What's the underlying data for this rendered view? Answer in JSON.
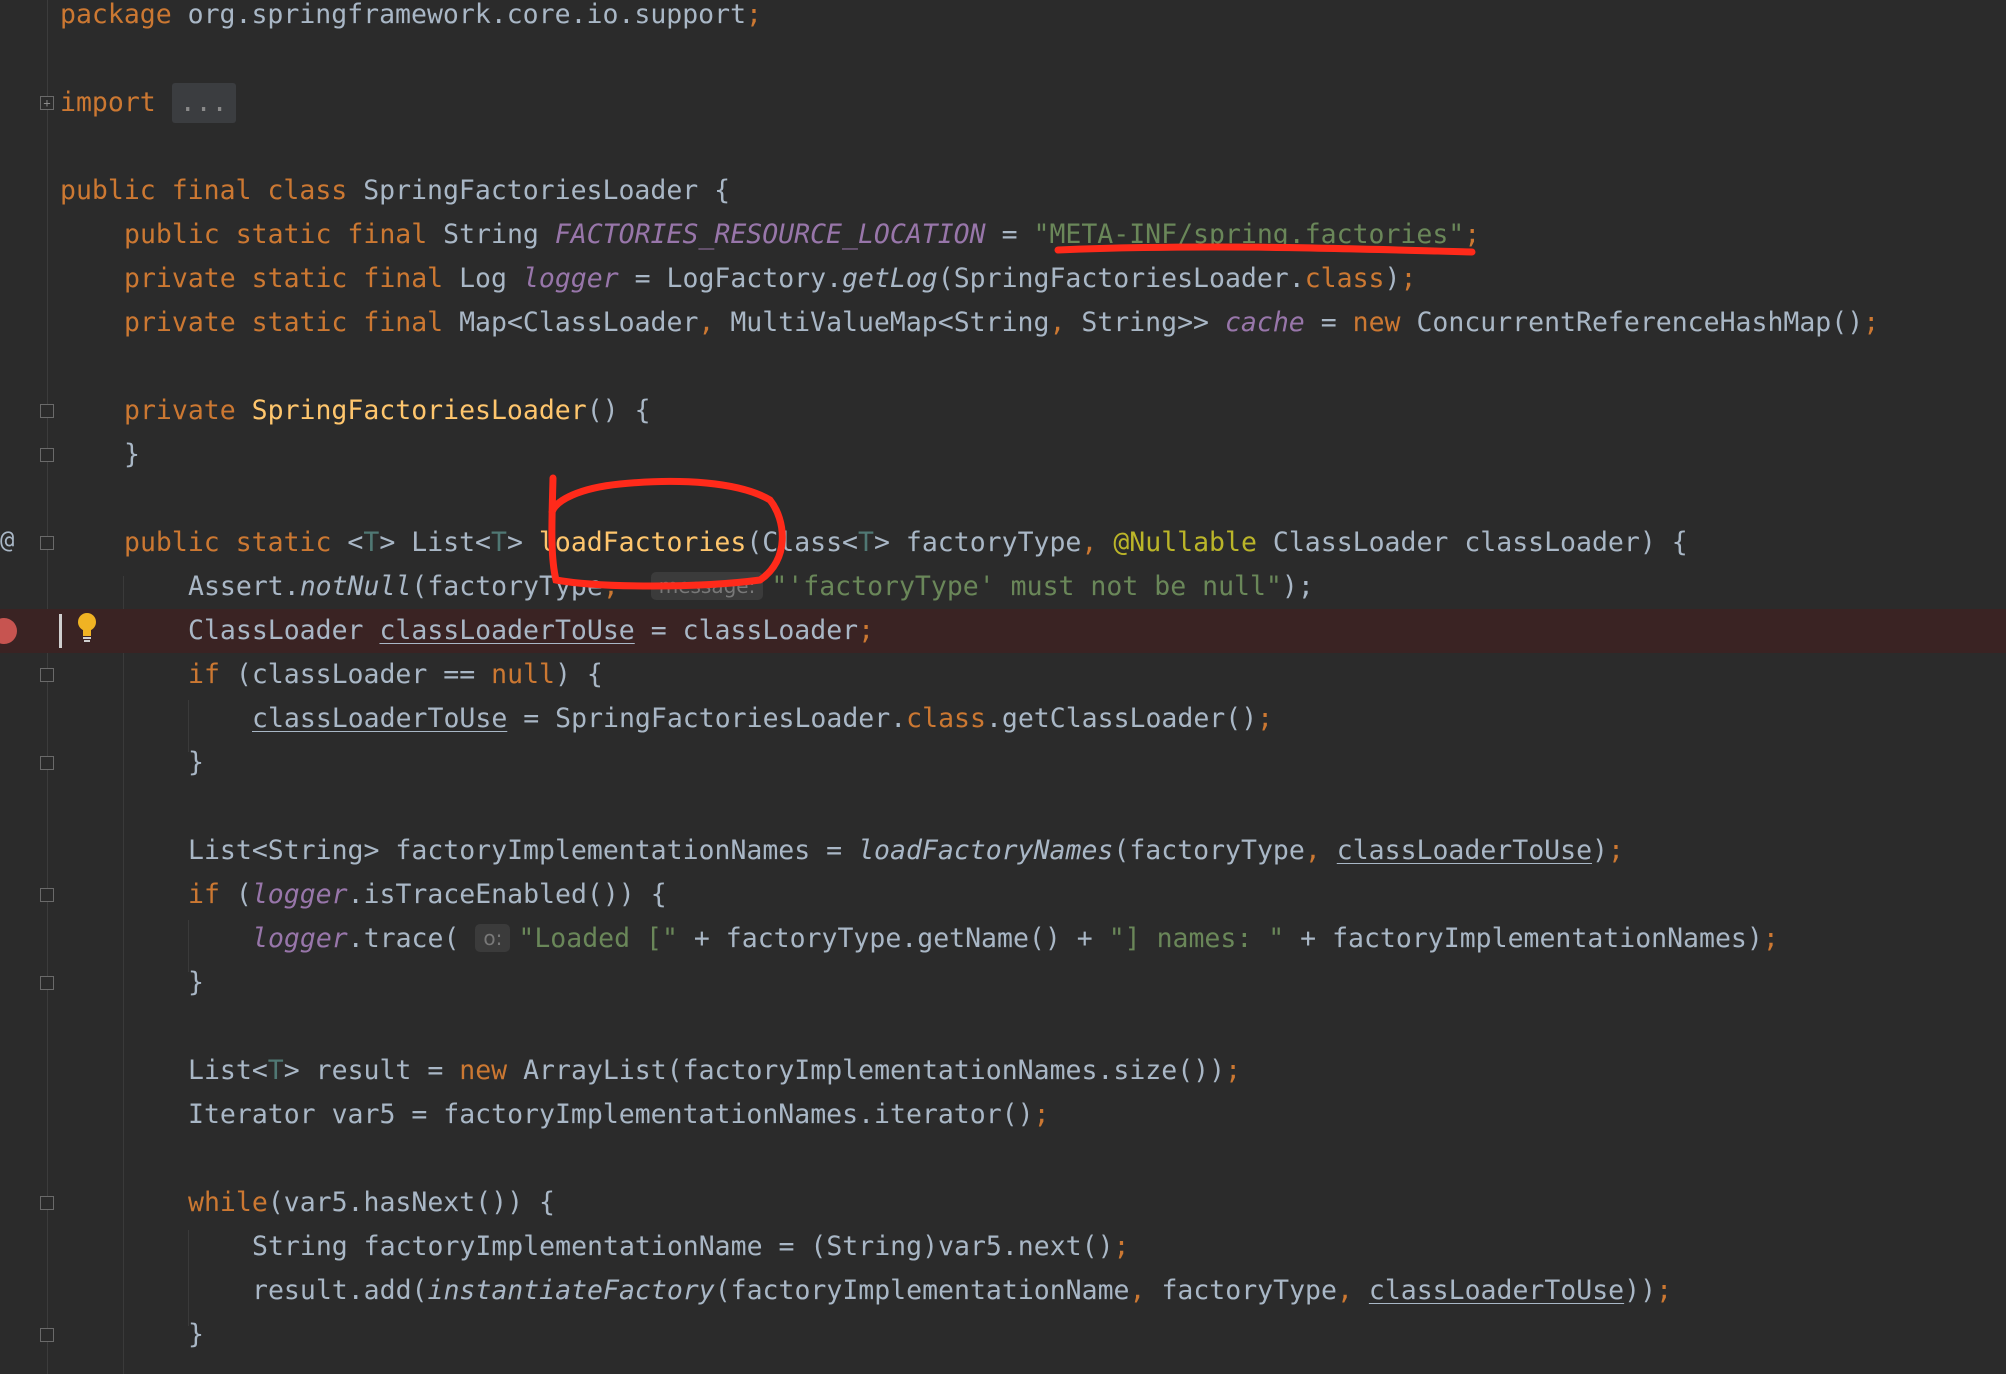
{
  "editor": {
    "file_language": "java",
    "colors": {
      "background": "#2b2b2b",
      "keyword": "#cc7832",
      "string": "#6a8759",
      "field": "#9876aa",
      "method": "#ffc66d",
      "annotation": "#bbb529",
      "breakpoint_line": "#3a2323",
      "annotation_ink": "#ff2a1a"
    },
    "gutter": {
      "breakpoint_icon": "breakpoint-icon",
      "lightbulb_icon": "lightbulb-icon",
      "implements_marker": "@"
    },
    "hints": {
      "message": "message:",
      "o": "o:"
    },
    "code": {
      "l1_kw": "package",
      "l1_rest": " org.springframework.core.io.support",
      "semi": ";",
      "l2_kw": "import",
      "l2_fold": "...",
      "kw_public": "public",
      "kw_private": "private",
      "kw_static": "static",
      "kw_final": "final",
      "kw_class": "class",
      "kw_new": "new",
      "kw_if": "if",
      "kw_null": "null",
      "kw_while": "while",
      "class_decl": " SpringFactoriesLoader {",
      "string_type": " String ",
      "const_name": "FACTORIES_RESOURCE_LOCATION",
      "eq": " = ",
      "const_value": "\"META-INF/spring.factories\"",
      "log_type": " Log ",
      "logger": "logger",
      "logfactory": "LogFactory.",
      "getlog": "getLog",
      "getlog_arg": "(SpringFactoriesLoader.",
      "close_paren": ")",
      "map_type": " Map<ClassLoader",
      "comma": ", ",
      "mvm_type": "MultiValueMap<String",
      "string_close": "String>> ",
      "cache": "cache",
      "crhm": "ConcurrentReferenceHashMap()",
      "ctor_name": "SpringFactoriesLoader",
      "ctor_rest": "() {",
      "close_brace": "}",
      "lt": " <",
      "T": "T",
      "gt_list": "> List<",
      "gt_sp": "> ",
      "method_name": "loadFactories",
      "class_param": "(Class<",
      "factory_type_param": "> factoryType",
      "nullable": "@Nullable",
      "cl_param": " ClassLoader classLoader) {",
      "assert_pre": "Assert.",
      "notnull": "notNull",
      "assert_arg": "(factoryType",
      "assert_msg": "\"'factoryType' must not be null\"",
      "assert_close": ");",
      "cl_decl_type": "ClassLoader ",
      "cl_to_use": "classLoaderToUse",
      "cl_assign_rhs": "classLoader",
      "if_open": " (classLoader == ",
      "if_close": ") {",
      "sfl_class_pre": "SpringFactoriesLoader.",
      "getcl": ".getClassLoader()",
      "names_decl": "List<String> factoryImplementationNames = ",
      "load_names": "loadFactoryNames",
      "names_args": "(factoryType",
      "if_paren": " (",
      "trace_enabled": ".isTraceEnabled()) {",
      "trace_call": ".trace(",
      "loaded_str": "\"Loaded [\"",
      "plus_gettype": " + factoryType.getName() + ",
      "names_str": "\"] names: \"",
      "plus_names": " + factoryImplementationNames)",
      "result_decl": "List<",
      "result_rest": "> result = ",
      "arraylist": " ArrayList(factoryImplementationNames.size())",
      "iter_decl": "Iterator var5 = factoryImplementationNames.iterator()",
      "while_rest": "(var5.hasNext()) {",
      "name_decl": "String factoryImplementationName = (String)var5.next()",
      "result_add": "result.add(",
      "instantiate": "instantiateFactory",
      "inst_args": "(factoryImplementationName",
      "factory_type_arg": "factoryType",
      "double_close": "))"
    }
  }
}
